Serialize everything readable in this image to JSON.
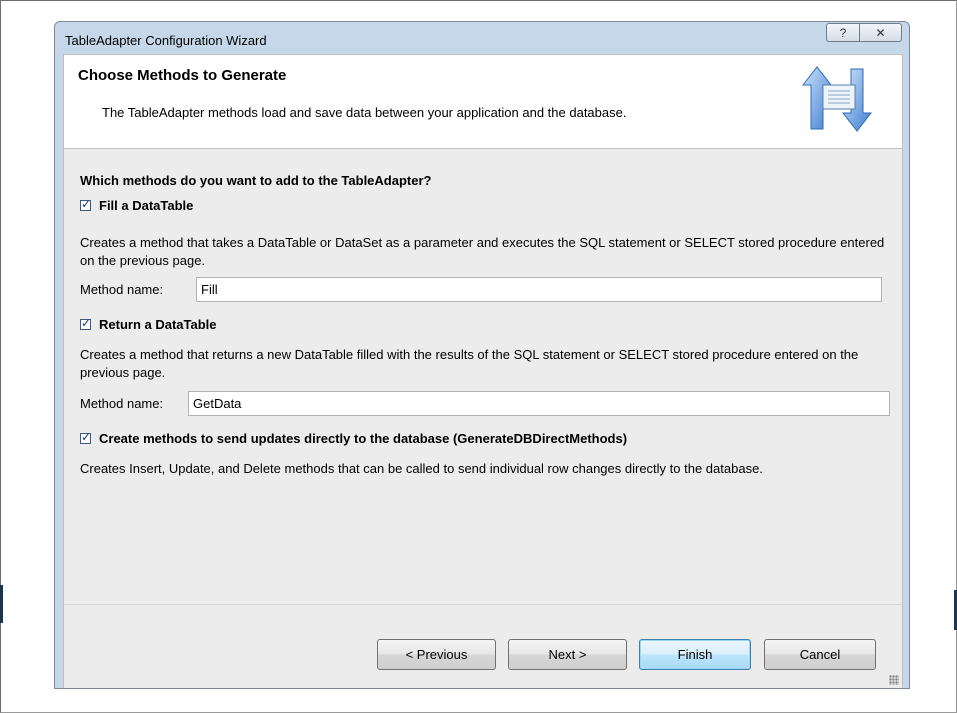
{
  "window": {
    "title": "TableAdapter Configuration Wizard",
    "help_label": "?",
    "close_label": "✕"
  },
  "header": {
    "title": "Choose Methods to Generate",
    "subtitle": "The TableAdapter methods load and save data between your application and the database.",
    "icon": "data-transfer-arrows-icon"
  },
  "content": {
    "question": "Which methods do you want to add to the TableAdapter?",
    "fill": {
      "checked": true,
      "label": "Fill a DataTable",
      "description": "Creates a method that takes a DataTable or DataSet as a parameter and executes the SQL statement or SELECT stored procedure entered on the previous page.",
      "method_label": "Method name:",
      "method_value": "Fill"
    },
    "return": {
      "checked": true,
      "label": "Return a DataTable",
      "description": "Creates a method that returns a new DataTable filled with the results of the SQL statement or SELECT stored procedure entered on the previous page.",
      "method_label": "Method name:",
      "method_value": "GetData"
    },
    "direct": {
      "checked": true,
      "label": "Create methods to send updates directly to the database (GenerateDBDirectMethods)",
      "description": "Creates Insert, Update, and Delete methods that can be called to send individual row changes directly to the database."
    }
  },
  "footer": {
    "previous_label": "< Previous",
    "next_label": "Next >",
    "finish_label": "Finish",
    "cancel_label": "Cancel"
  },
  "colors": {
    "frame": "#c5d7e9",
    "panel": "#ececec",
    "header": "#ffffff",
    "icon_blue": "#4a86cf"
  }
}
